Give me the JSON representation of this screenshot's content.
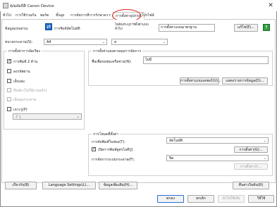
{
  "window": {
    "title": "คุณสมบัติ Canon Device",
    "close": "✕"
  },
  "tabs": [
    {
      "label": "ทั่วไป",
      "active": false
    },
    {
      "label": "การใช้ร่วมกัน",
      "active": false
    },
    {
      "label": "พอร์ต",
      "active": false
    },
    {
      "label": "ขั้นสูง",
      "active": false
    },
    {
      "label": "การจัดการสี",
      "active": false
    },
    {
      "label": "การรักษาความปลอดภัย",
      "active": false
    },
    {
      "label": "การตั้งค่าอุปกรณ์",
      "active": true
    },
    {
      "label": "โปรไฟล์",
      "active": false
    }
  ],
  "profile": {
    "label": "ข้อมูลแบบด่วน:",
    "sync_label": "การซิงค์อัตโนมัติ",
    "info_label": "ไม่ต้องระบุการตั้งค่าแบบทั่วไป",
    "value": "การตั้งค่าแบบมาตรฐาน",
    "edit_button": "แก้ไข(E)...",
    "green_icon": "↑",
    "blue_icon": "⇄"
  },
  "paper": {
    "label": "ขนาดกระดาษ(S):",
    "value": "A4",
    "orientation_value": "ส"
  },
  "left_group": {
    "title": "การตั้งค่าการจัดเรียง",
    "items": [
      {
        "label": "การพิมพ์ 2 ด้าน",
        "checked": true,
        "disabled": false
      },
      {
        "label": "ลงรหัสผ่าน",
        "checked": false,
        "disabled": false
      },
      {
        "label": "เย็บเล่ม",
        "checked": false,
        "disabled": false
      },
      {
        "label": "บีบอัด (ไม่ใช้งานแล้ว)",
        "checked": false,
        "disabled": true
      },
      {
        "label": "เย็บมุมกระดาษ",
        "checked": false,
        "disabled": true
      },
      {
        "label": "เจาะรู(P)",
        "checked": false,
        "disabled": false
      }
    ],
    "dropdown_value": "2 รู"
  },
  "right_group": {
    "title": "การตั้งค่าแผงควบคุมการจัดการ",
    "label": "ชื่อเพื่อขอชมเครือข่าย(N):",
    "value": "ไม่มี",
    "buttons": [
      "การตั้งค่าแบบเลเซอร์(U)...",
      "แสดงรายการข้อมูล(D)..."
    ]
  },
  "options_group": {
    "title": "การโหมดที่ตั้งค่า",
    "rows": [
      {
        "label": "การจัดพิมพ์ในช่อง(T):",
        "value": "อัตโนมัติ"
      },
      {
        "label": "เปิดการพิมพ์สูตรไอดี(J)",
        "checked": true,
        "button": "การตั้งค่า(G)..."
      },
      {
        "label": "การจัดการระบบกระดาษ(F):",
        "value": "ปิด",
        "button": "การตั้งค่า(I)..."
      }
    ]
  },
  "footer_buttons": {
    "about": "เกี่ยวกับ(B)",
    "language": "Language Settings(L)...",
    "detail": "ข้อมูลเพิ่มเติม(H)...",
    "restore": "คืนค่าเริ่มต้น(R)"
  },
  "dialog_buttons": {
    "ok": "ตกลง",
    "cancel": "ยกเลิก",
    "apply": "นำไปใช้(A)",
    "help": "วิธีใช้"
  },
  "colors": {
    "highlight": "#e0261c",
    "primary_border": "#2a6fd6"
  }
}
